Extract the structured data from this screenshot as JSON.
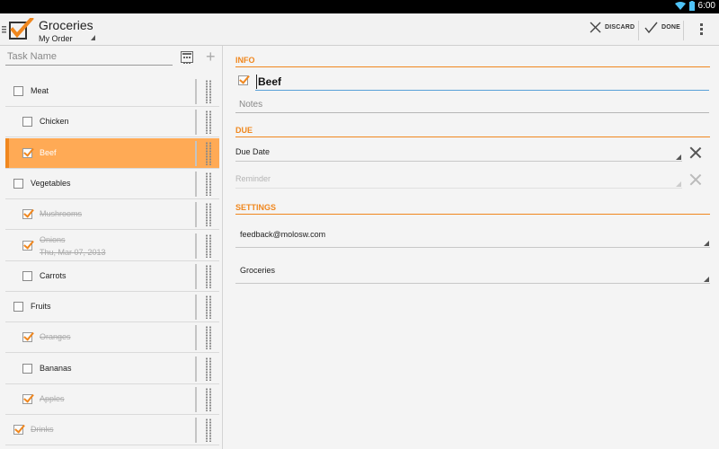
{
  "status_bar": {
    "time": "6:00",
    "wifi_icon": "wifi-icon",
    "battery_icon": "battery-icon"
  },
  "action_bar": {
    "app_icon": "checkbox-logo-icon",
    "title": "Groceries",
    "subtitle": "My Order",
    "discard_label": "DISCARD",
    "done_label": "DONE",
    "overflow_icon": "overflow-menu-icon"
  },
  "left_pane": {
    "task_name_placeholder": "Task Name",
    "tasks": [
      {
        "label": "Meat",
        "checked": false,
        "indent": 0,
        "completed": false,
        "date": ""
      },
      {
        "label": "Chicken",
        "checked": false,
        "indent": 1,
        "completed": false,
        "date": ""
      },
      {
        "label": "Beef",
        "checked": true,
        "indent": 1,
        "completed": false,
        "date": "",
        "selected": true
      },
      {
        "label": "Vegetables",
        "checked": false,
        "indent": 0,
        "completed": false,
        "date": ""
      },
      {
        "label": "Mushrooms",
        "checked": true,
        "indent": 1,
        "completed": true,
        "date": ""
      },
      {
        "label": "Onions",
        "checked": true,
        "indent": 1,
        "completed": true,
        "date": "Thu, Mar 07, 2013"
      },
      {
        "label": "Carrots",
        "checked": false,
        "indent": 1,
        "completed": false,
        "date": ""
      },
      {
        "label": "Fruits",
        "checked": false,
        "indent": 0,
        "completed": false,
        "date": ""
      },
      {
        "label": "Oranges",
        "checked": true,
        "indent": 1,
        "completed": true,
        "date": ""
      },
      {
        "label": "Bananas",
        "checked": false,
        "indent": 1,
        "completed": false,
        "date": ""
      },
      {
        "label": "Apples",
        "checked": true,
        "indent": 1,
        "completed": true,
        "date": ""
      },
      {
        "label": "Drinks",
        "checked": true,
        "indent": 0,
        "completed": true,
        "date": ""
      }
    ]
  },
  "right_pane": {
    "info_header": "INFO",
    "task_name_value": "Beef",
    "notes_placeholder": "Notes",
    "due_header": "DUE",
    "due_date_label": "Due Date",
    "reminder_label": "Reminder",
    "settings_header": "SETTINGS",
    "account_value": "feedback@molosw.com",
    "list_value": "Groceries"
  },
  "colors": {
    "accent": "#f0871e",
    "selected_row": "#ffaa55",
    "focus_underline": "#58a0d8"
  }
}
